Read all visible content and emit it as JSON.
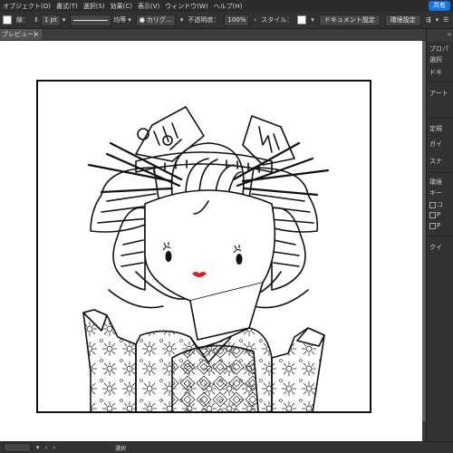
{
  "menu": {
    "items": [
      "オブジェクト(O)",
      "書式(T)",
      "選択(S)",
      "効果(C)",
      "表示(V)",
      "ウィンドウ(W)",
      "ヘルプ(H)"
    ],
    "share_label": "共有"
  },
  "control_bar": {
    "stroke_label": "線：",
    "stroke_weight": "1 pt",
    "stroke_profile": "均等",
    "brush": "カリグ…",
    "opacity_label": "不透明度：",
    "opacity_value": "100%",
    "style_label": "スタイル：",
    "doc_settings_label": "ドキュメント設定",
    "prefs_label": "環境設定"
  },
  "document_tab": {
    "title": "ブレビュー)",
    "close_glyph": "×"
  },
  "right_panel": {
    "labels": [
      "プロパ",
      "選択",
      "ドキ",
      "アート",
      "定規",
      "ガイ",
      "スナ",
      "環境",
      "キー",
      "コ",
      "P",
      "P",
      "クイ"
    ]
  },
  "status": {
    "zoom": "",
    "tool": "選択"
  },
  "colors": {
    "app_bg": "#535353",
    "menubar_bg": "#2b2b2b",
    "panel_bg": "#323232",
    "accent_share": "#1473e6",
    "lips": "#d81c2a"
  },
  "icons": [
    "menu-icon",
    "stroke-arrow-icon",
    "brush-dot-icon",
    "style-swatch-icon",
    "arrange-icon",
    "chevron-icon"
  ]
}
